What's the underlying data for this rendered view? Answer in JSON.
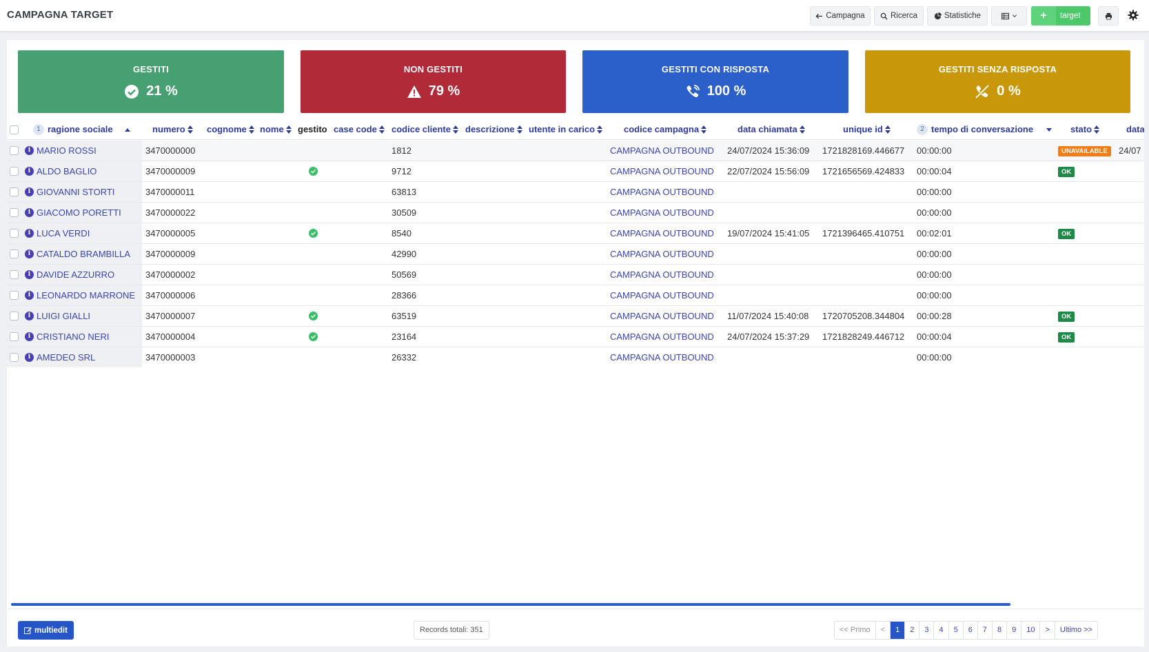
{
  "header": {
    "title": "CAMPAGNA TARGET",
    "btn_campagna": "Campagna",
    "btn_ricerca": "Ricerca",
    "btn_statistiche": "Statistiche",
    "btn_target": "target"
  },
  "stats": [
    {
      "title": "GESTITI",
      "value": "21 %",
      "icon": "check-circle-icon",
      "color": "#47a072"
    },
    {
      "title": "NON GESTITI",
      "value": "79 %",
      "icon": "warning-icon",
      "color": "#b02a37"
    },
    {
      "title": "GESTITI CON RISPOSTA",
      "value": "100 %",
      "icon": "phone-volume-icon",
      "color": "#2b5fc9"
    },
    {
      "title": "GESTITI SENZA RISPOSTA",
      "value": "0 %",
      "icon": "phone-slash-icon",
      "color": "#c9980a"
    }
  ],
  "table": {
    "columns": {
      "ragione_sociale": "ragione sociale",
      "ragione_sociale_order": "1",
      "numero": "numero",
      "cognome": "cognome",
      "nome": "nome",
      "gestito": "gestito",
      "case_code": "case code",
      "codice_cliente": "codice cliente",
      "descrizione": "descrizione",
      "utente_in_carico": "utente in carico",
      "codice_campagna": "codice campagna",
      "data_chiamata": "data chiamata",
      "unique_id": "unique id",
      "tempo": "tempo di conversazione",
      "tempo_order": "2",
      "stato": "stato",
      "data_trunc": "data"
    },
    "rows": [
      {
        "ragione": "MARIO ROSSI",
        "numero": "3470000000",
        "gestito": false,
        "codice_cliente": "1812",
        "campagna": "CAMPAGNA OUTBOUND",
        "data": "24/07/2024 15:36:09",
        "unique_id": "1721828169.446677",
        "tempo": "00:00:00",
        "stato": "UNAVAILABLE",
        "extra": "24/07"
      },
      {
        "ragione": "ALDO BAGLIO",
        "numero": "3470000009",
        "gestito": true,
        "codice_cliente": "9712",
        "campagna": "CAMPAGNA OUTBOUND",
        "data": "22/07/2024 15:56:09",
        "unique_id": "1721656569.424833",
        "tempo": "00:00:04",
        "stato": "OK",
        "extra": ""
      },
      {
        "ragione": "GIOVANNI STORTI",
        "numero": "3470000011",
        "gestito": false,
        "codice_cliente": "63813",
        "campagna": "CAMPAGNA OUTBOUND",
        "data": "",
        "unique_id": "",
        "tempo": "00:00:00",
        "stato": "",
        "extra": ""
      },
      {
        "ragione": "GIACOMO PORETTI",
        "numero": "3470000022",
        "gestito": false,
        "codice_cliente": "30509",
        "campagna": "CAMPAGNA OUTBOUND",
        "data": "",
        "unique_id": "",
        "tempo": "00:00:00",
        "stato": "",
        "extra": ""
      },
      {
        "ragione": "LUCA VERDI",
        "numero": "3470000005",
        "gestito": true,
        "codice_cliente": "8540",
        "campagna": "CAMPAGNA OUTBOUND",
        "data": "19/07/2024 15:41:05",
        "unique_id": "1721396465.410751",
        "tempo": "00:02:01",
        "stato": "OK",
        "extra": ""
      },
      {
        "ragione": "CATALDO BRAMBILLA",
        "numero": "3470000009",
        "gestito": false,
        "codice_cliente": "42990",
        "campagna": "CAMPAGNA OUTBOUND",
        "data": "",
        "unique_id": "",
        "tempo": "00:00:00",
        "stato": "",
        "extra": ""
      },
      {
        "ragione": "DAVIDE AZZURRO",
        "numero": "3470000002",
        "gestito": false,
        "codice_cliente": "50569",
        "campagna": "CAMPAGNA OUTBOUND",
        "data": "",
        "unique_id": "",
        "tempo": "00:00:00",
        "stato": "",
        "extra": ""
      },
      {
        "ragione": "LEONARDO MARRONE",
        "numero": "3470000006",
        "gestito": false,
        "codice_cliente": "28366",
        "campagna": "CAMPAGNA OUTBOUND",
        "data": "",
        "unique_id": "",
        "tempo": "00:00:00",
        "stato": "",
        "extra": ""
      },
      {
        "ragione": "LUIGI GIALLI",
        "numero": "3470000007",
        "gestito": true,
        "codice_cliente": "63519",
        "campagna": "CAMPAGNA OUTBOUND",
        "data": "11/07/2024 15:40:08",
        "unique_id": "1720705208.344804",
        "tempo": "00:00:28",
        "stato": "OK",
        "extra": ""
      },
      {
        "ragione": "CRISTIANO NERI",
        "numero": "3470000004",
        "gestito": true,
        "codice_cliente": "23164",
        "campagna": "CAMPAGNA OUTBOUND",
        "data": "24/07/2024 15:37:29",
        "unique_id": "1721828249.446712",
        "tempo": "00:00:04",
        "stato": "OK",
        "extra": ""
      },
      {
        "ragione": "AMEDEO SRL",
        "numero": "3470000003",
        "gestito": false,
        "codice_cliente": "26332",
        "campagna": "CAMPAGNA OUTBOUND",
        "data": "",
        "unique_id": "",
        "tempo": "00:00:00",
        "stato": "",
        "extra": ""
      }
    ]
  },
  "footer": {
    "multiedit": "multiedit",
    "records": "Records totali: 351",
    "pager": [
      "<< Primo",
      "<",
      "1",
      "2",
      "3",
      "4",
      "5",
      "6",
      "7",
      "8",
      "9",
      "10",
      ">",
      "Ultimo >>"
    ],
    "active_page": "1"
  }
}
